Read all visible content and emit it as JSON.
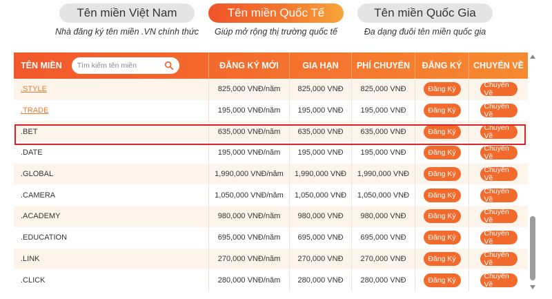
{
  "tabs": [
    {
      "label": "Tên miền Việt Nam",
      "desc": "Nhà đăng ký tên miền .VN chính thức"
    },
    {
      "label": "Tên miền Quốc Tế",
      "desc": "Giúp mở rộng thị trường quốc tế"
    },
    {
      "label": "Tên miền Quốc Gia",
      "desc": "Đa dạng đuôi tên miền quốc gia"
    }
  ],
  "table": {
    "headers": [
      "TÊN MIỀN",
      "ĐĂNG KÝ MỚI",
      "GIA HẠN",
      "PHÍ CHUYỂN",
      "ĐĂNG KÝ",
      "CHUYỂN VỀ"
    ],
    "search_placeholder": "Tìm kiếm tên miền",
    "register_label": "Đăng Ký",
    "transfer_label": "Chuyển Về",
    "rows": [
      {
        "name": ".STYLE",
        "new": "825,000 VNĐ/năm",
        "renew": "825,000 VNĐ",
        "transfer": "825,000 VNĐ"
      },
      {
        "name": ".TRADE",
        "new": "195,000 VNĐ/năm",
        "renew": "195,000 VNĐ",
        "transfer": "195,000 VNĐ"
      },
      {
        "name": ".BET",
        "new": "635,000 VNĐ/năm",
        "renew": "635,000 VNĐ",
        "transfer": "635,000 VNĐ"
      },
      {
        "name": ".DATE",
        "new": "195,000 VNĐ/năm",
        "renew": "195,000 VNĐ",
        "transfer": "195,000 VNĐ"
      },
      {
        "name": ".GLOBAL",
        "new": "1,990,000 VNĐ/năm",
        "renew": "1,990,000 VNĐ",
        "transfer": "1,990,000 VNĐ"
      },
      {
        "name": ".CAMERA",
        "new": "1,050,000 VNĐ/năm",
        "renew": "1,050,000 VNĐ",
        "transfer": "1,050,000 VNĐ"
      },
      {
        "name": ".ACADEMY",
        "new": "980,000 VNĐ/năm",
        "renew": "980,000 VNĐ",
        "transfer": "980,000 VNĐ"
      },
      {
        "name": ".EDUCATION",
        "new": "695,000 VNĐ/năm",
        "renew": "695,000 VNĐ",
        "transfer": "695,000 VNĐ"
      },
      {
        "name": ".LINK",
        "new": "270,000 VNĐ/năm",
        "renew": "270,000 VNĐ",
        "transfer": "270,000 VNĐ"
      },
      {
        "name": ".CLICK",
        "new": "280,000 VNĐ/năm",
        "renew": "280,000 VNĐ",
        "transfer": "280,000 VNĐ"
      }
    ]
  },
  "colors": {
    "accent": "#f26a2c",
    "highlight": "#d9222a",
    "row_alt": "#fdf5ec"
  },
  "icons": {
    "search": "search-icon"
  }
}
